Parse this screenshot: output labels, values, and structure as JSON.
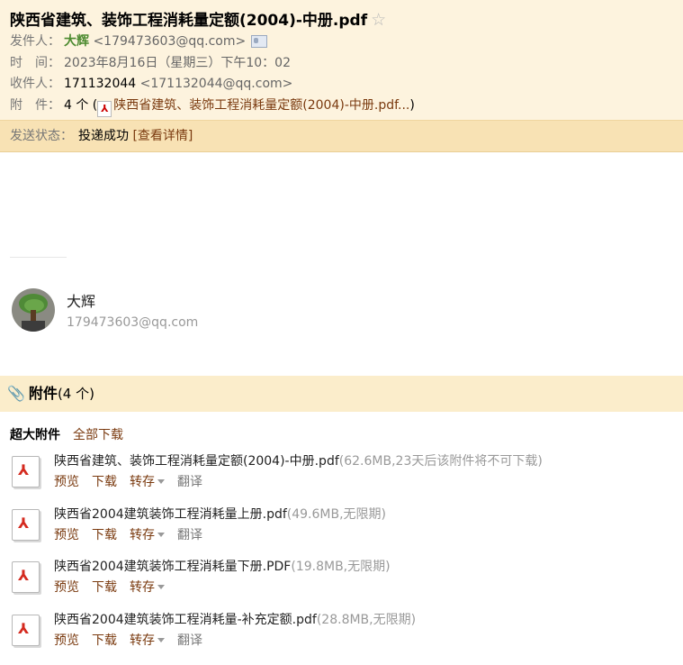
{
  "mail": {
    "subject": "陕西省建筑、装饰工程消耗量定额(2004)-中册.pdf",
    "star_icon": "☆",
    "sender_label": "发件人：",
    "sender_name": "大辉",
    "sender_email": "<179473603@qq.com>",
    "time_label": "时　间：",
    "time": "2023年8月16日（星期三）下午10：02",
    "recipient_label": "收件人：",
    "recipient_name": "171132044",
    "recipient_email": "<171132044@qq.com>",
    "attachment_label": "附　件：",
    "attachment_count": "4 个 (",
    "attachment_link": "陕西省建筑、装饰工程消耗量定额(2004)-中册.pdf...",
    "attachment_close": ")"
  },
  "status": {
    "label": "发送状态：",
    "value": "投递成功",
    "detail_link": "[查看详情]"
  },
  "signature": {
    "name": "大辉",
    "email": "179473603@qq.com"
  },
  "attachments": {
    "title": "附件",
    "count": "(4 个)",
    "super_label": "超大附件",
    "download_all": "全部下载",
    "files": [
      {
        "name": "陕西省建筑、装饰工程消耗量定额(2004)-中册.pdf",
        "info": "(62.6MB,23天后该附件将不可下载)",
        "preview": "预览",
        "download": "下载",
        "save": "转存",
        "translate": "翻译"
      },
      {
        "name": "陕西省2004建筑装饰工程消耗量上册.pdf",
        "info": "(49.6MB,无限期)",
        "preview": "预览",
        "download": "下载",
        "save": "转存",
        "translate": "翻译"
      },
      {
        "name": "陕西省2004建筑装饰工程消耗量下册.PDF",
        "info": "(19.8MB,无限期)",
        "preview": "预览",
        "download": "下载",
        "save": "转存",
        "translate": ""
      },
      {
        "name": "陕西省2004建筑装饰工程消耗量-补充定额.pdf",
        "info": "(28.8MB,无限期)",
        "preview": "预览",
        "download": "下载",
        "save": "转存",
        "translate": "翻译"
      }
    ]
  },
  "colors": {
    "header_bg": "#fdf3de",
    "status_bg": "#f8e2b4",
    "link": "#7a3a0f",
    "sender_green": "#4c8a2f"
  }
}
